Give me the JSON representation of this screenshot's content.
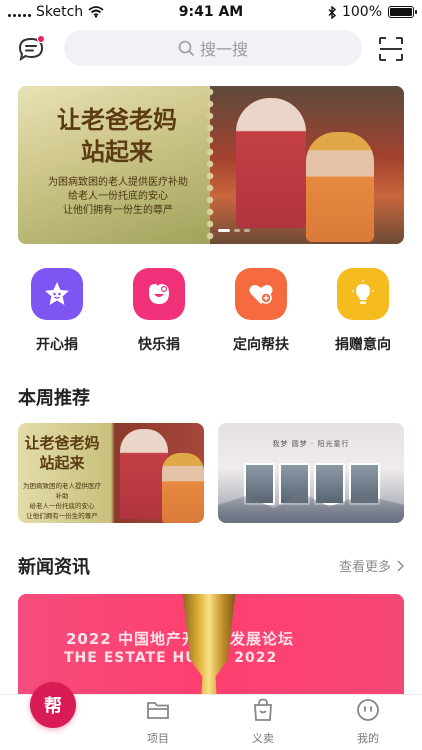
{
  "status_bar": {
    "carrier": "Sketch",
    "time": "9:41 AM",
    "battery": "100%",
    "battery_level": 1.0
  },
  "header": {
    "message_icon": "chat-bubble-icon",
    "search_placeholder": "搜一搜",
    "scan_icon": "scan-icon"
  },
  "banner": {
    "title_line1": "让老爸老妈",
    "title_line2": "站起来",
    "sub_line1": "为困病致困的老人提供医疗补助",
    "sub_line2": "给老人一份托底的安心",
    "sub_line3": "让他们拥有一份生的尊严",
    "active_slide": 1,
    "slide_count": 3
  },
  "categories": [
    {
      "label": "开心捐",
      "icon": "star-face-icon",
      "color": "#7c55f3"
    },
    {
      "label": "快乐捐",
      "icon": "smile-face-icon",
      "color": "#f1307a"
    },
    {
      "label": "定向帮扶",
      "icon": "heart-plus-icon",
      "color": "#f56a3f"
    },
    {
      "label": "捐赠意向",
      "icon": "lightbulb-icon",
      "color": "#f5bb1f"
    }
  ],
  "weekly": {
    "title": "本周推荐",
    "card1": {
      "title_line1": "让老爸老妈",
      "title_line2": "站起来",
      "sub_line1": "为困病致困的老人提供医疗补助",
      "sub_line2": "给老人一份托底的安心",
      "sub_line3": "让他们拥有一份生的尊严"
    },
    "card2": {
      "caption": "我梦 圆梦 · 阳光童行"
    }
  },
  "news": {
    "title": "新闻资讯",
    "more": "查看更多",
    "line1": "2022 中国地产开发者发展论坛",
    "line2": "THE ESTATE HU  O / 2022"
  },
  "tab_bar": {
    "home": "帮",
    "projects": "项目",
    "charity_sale": "义卖",
    "mine": "我的"
  },
  "colors": {
    "accent": "#d81b55",
    "search_bg": "#f1f2f6"
  }
}
